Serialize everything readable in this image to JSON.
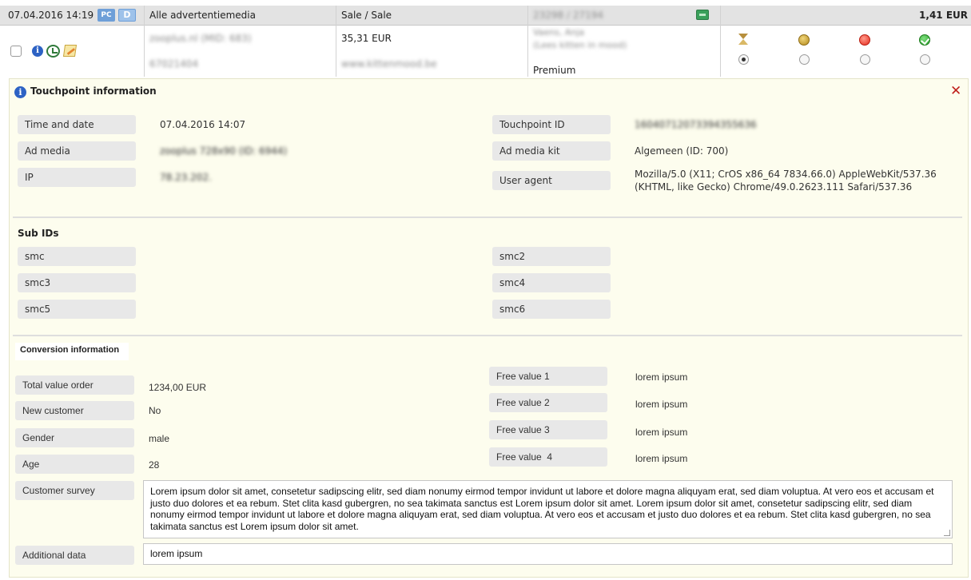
{
  "transaction": {
    "datetime": "07.04.2016 14:19",
    "badge_pc": "PC",
    "badge_d": "D",
    "media": "Alle advertentiemedia",
    "type": "Sale / Sale",
    "ids": "23298 / 27194",
    "commission": "1,41 EUR",
    "publisher_line1": "zooplus.nl (MID: 683)",
    "publisher_line2": "67021404",
    "amount": "35,31 EUR",
    "website": "www.kittenmood.be",
    "customer_line1": "Vaens, Anja",
    "customer_line2": "(Lees kitten in mood)",
    "tier": "Premium",
    "status_selected": "pending"
  },
  "touchpoint": {
    "title": "Touchpoint information",
    "fields": {
      "time_label": "Time and date",
      "time_value": "07.04.2016 14:07",
      "admedia_label": "Ad media",
      "admedia_value": "zooplus 728x90 (ID: 6944)",
      "ip_label": "IP",
      "ip_value": "78.23.202.",
      "tpid_label": "Touchpoint ID",
      "tpid_value": "16040712073394355636",
      "kit_label": "Ad media kit",
      "kit_value": "Algemeen (ID: 700)",
      "ua_label": "User agent",
      "ua_line1": "Mozilla/5.0 (X11; CrOS x86_64 7834.66.0) AppleWebKit/537.36",
      "ua_line2": "(KHTML, like Gecko) Chrome/49.0.2623.111 Safari/537.36"
    }
  },
  "subids": {
    "title": "Sub IDs",
    "labels": [
      "smc",
      "smc2",
      "smc3",
      "smc4",
      "smc5",
      "smc6"
    ]
  },
  "conversion": {
    "title": "Conversion information",
    "total_label": "Total value order",
    "total_value": "1234,00 EUR",
    "newcust_label": "New customer",
    "newcust_value": "No",
    "gender_label": "Gender",
    "gender_value": "male",
    "age_label": "Age",
    "age_value": "28",
    "free1_label": "Free value 1",
    "free1_value": "lorem ipsum",
    "free2_label": "Free value 2",
    "free2_value": "lorem ipsum",
    "free3_label": "Free value 3",
    "free3_value": "lorem ipsum",
    "free4_label": "Free value  4",
    "free4_value": "lorem ipsum",
    "survey_label": "Customer survey",
    "survey_text": "Lorem ipsum dolor sit amet, consetetur sadipscing elitr, sed diam nonumy eirmod tempor invidunt ut labore et dolore magna aliquyam erat, sed diam voluptua. At vero eos et accusam et justo duo dolores et ea rebum. Stet clita kasd gubergren, no sea takimata sanctus est Lorem ipsum dolor sit amet. Lorem ipsum dolor sit amet, consetetur sadipscing elitr, sed diam nonumy eirmod tempor invidunt ut labore et dolore magna aliquyam erat, sed diam voluptua. At vero eos et accusam et justo duo dolores et ea rebum. Stet clita kasd gubergren, no sea takimata sanctus est Lorem ipsum dolor sit amet.",
    "additional_label": "Additional data",
    "additional_value": "lorem ipsum"
  },
  "colors": {
    "panel_bg": "#fdfdee",
    "label_bg": "#e8e8e8",
    "close": "#c0201c",
    "info": "#2d62c4"
  },
  "icons": [
    "info-icon",
    "history-icon",
    "edit-icon",
    "money-icon",
    "hourglass-icon",
    "open-status-icon",
    "rejected-status-icon",
    "approved-status-icon",
    "close-icon"
  ]
}
